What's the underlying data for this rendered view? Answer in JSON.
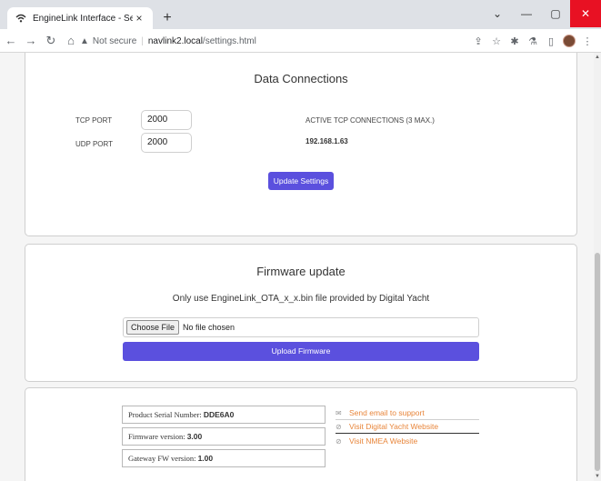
{
  "browser": {
    "tab_title": "EngineLink Interface - Settings",
    "tab_close": "×",
    "new_tab": "+",
    "security_label": "Not secure",
    "url_host": "navlink2.local",
    "url_path": "/settings.html"
  },
  "data_connections": {
    "title": "Data Connections",
    "tcp_port_label": "TCP PORT",
    "tcp_port_value": "2000",
    "udp_port_label": "UDP PORT",
    "udp_port_value": "2000",
    "active_connections_label": "ACTIVE TCP CONNECTIONS (3 Max.)",
    "active_ip": "192.168.1.63",
    "update_button": "Update Settings"
  },
  "firmware": {
    "title": "Firmware update",
    "note": "Only use EngineLink_OTA_x_x.bin file provided by Digital Yacht",
    "choose_file_button": "Choose File",
    "file_status": "No file chosen",
    "upload_button": "Upload Firmware"
  },
  "info": {
    "serial_label": "Product Serial Number: ",
    "serial_value": "DDE6A0",
    "fw_label": "Firmware version: ",
    "fw_value": "3.00",
    "gw_label": "Gateway FW version: ",
    "gw_value": "1.00",
    "link_support": "Send email to support",
    "link_digital_yacht": "Visit Digital Yacht Website",
    "link_nmea": "Visit NMEA Website"
  },
  "colors": {
    "primary_button": "#5b50de",
    "link": "#e8853a",
    "close_button": "#e81123"
  }
}
